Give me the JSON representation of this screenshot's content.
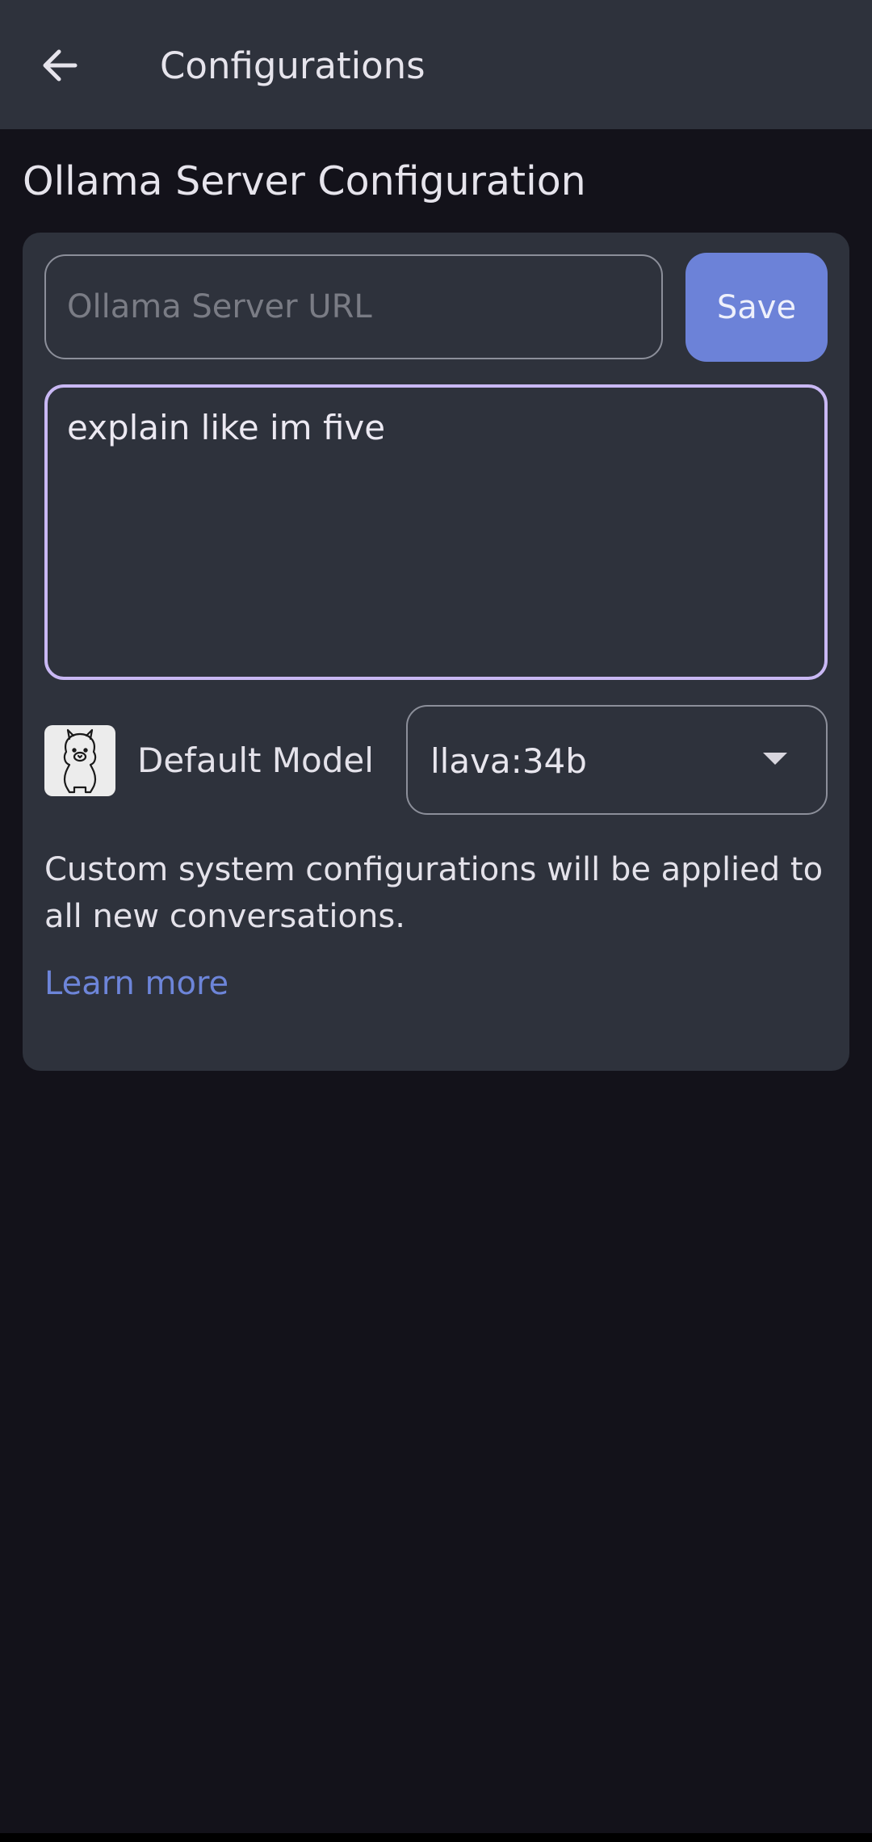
{
  "app_bar": {
    "title": "Configurations",
    "back_icon": "arrow-left-icon"
  },
  "section": {
    "title": "Ollama Server Configuration"
  },
  "server": {
    "url_value": "",
    "url_placeholder": "Ollama Server URL",
    "save_label": "Save"
  },
  "system_prompt": {
    "value": "explain like im five "
  },
  "model": {
    "avatar_icon": "llama-icon",
    "label": "Default Model",
    "selected": "llava:34b",
    "dropdown_icon": "caret-down-icon"
  },
  "hint": {
    "text": "Custom system configurations will be applied to all new conversations.",
    "link_label": "Learn more"
  },
  "colors": {
    "app_bar_bg": "#2e323c",
    "page_bg": "#13121a",
    "accent": "#6c82d8",
    "focus_border": "#c9b8f4",
    "link": "#6d85d9"
  }
}
